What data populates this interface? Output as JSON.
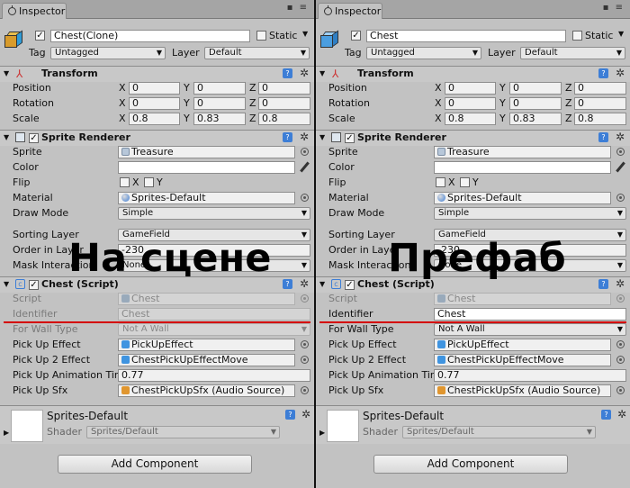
{
  "overlay": {
    "left": "На сцене",
    "right": "Префаб"
  },
  "common": {
    "tab_label": "Inspector",
    "tag_label": "Tag",
    "tag_value": "Untagged",
    "layer_label": "Layer",
    "layer_value": "Default",
    "static_label": "Static",
    "transform": {
      "title": "Transform",
      "position_label": "Position",
      "rotation_label": "Rotation",
      "scale_label": "Scale",
      "x_label": "X",
      "y_label": "Y",
      "z_label": "Z",
      "position": [
        "0",
        "0",
        "0"
      ],
      "rotation": [
        "0",
        "0",
        "0"
      ],
      "scale": [
        "0.8",
        "0.83",
        "0.8"
      ]
    },
    "sprite_renderer": {
      "title": "Sprite Renderer",
      "sprite_label": "Sprite",
      "sprite_value": "Treasure",
      "color_label": "Color",
      "flip_label": "Flip",
      "flip_x": "X",
      "flip_y": "Y",
      "material_label": "Material",
      "material_value": "Sprites-Default",
      "draw_mode_label": "Draw Mode",
      "draw_mode_value": "Simple",
      "sorting_layer_label": "Sorting Layer",
      "sorting_layer_value": "GameField",
      "order_label": "Order in Layer",
      "order_value": "-230",
      "mask_label": "Mask Interaction",
      "mask_value": "None"
    },
    "chest_script": {
      "title": "Chest (Script)",
      "script_label": "Script",
      "script_value": "Chest",
      "identifier_label": "Identifier",
      "for_wall_label": "For Wall Type",
      "for_wall_value": "Not A Wall",
      "pickup_effect_label": "Pick Up Effect",
      "pickup_effect_value": "PickUpEffect",
      "pickup2_label": "Pick Up 2 Effect",
      "pickup2_value": "ChestPickUpEffectMove",
      "anim_label": "Pick Up Animation Tim",
      "anim_value": "0.77",
      "sfx_label": "Pick Up Sfx",
      "sfx_value": "ChestPickUpSfx (Audio Source)"
    },
    "material_preview": {
      "name": "Sprites-Default",
      "shader_label": "Shader",
      "shader_value": "Sprites/Default"
    },
    "add_component": "Add Component"
  },
  "left": {
    "object_name": "Chest(Clone)",
    "identifier_value": "Chest"
  },
  "right": {
    "object_name": "Chest",
    "identifier_value": "Chest"
  }
}
